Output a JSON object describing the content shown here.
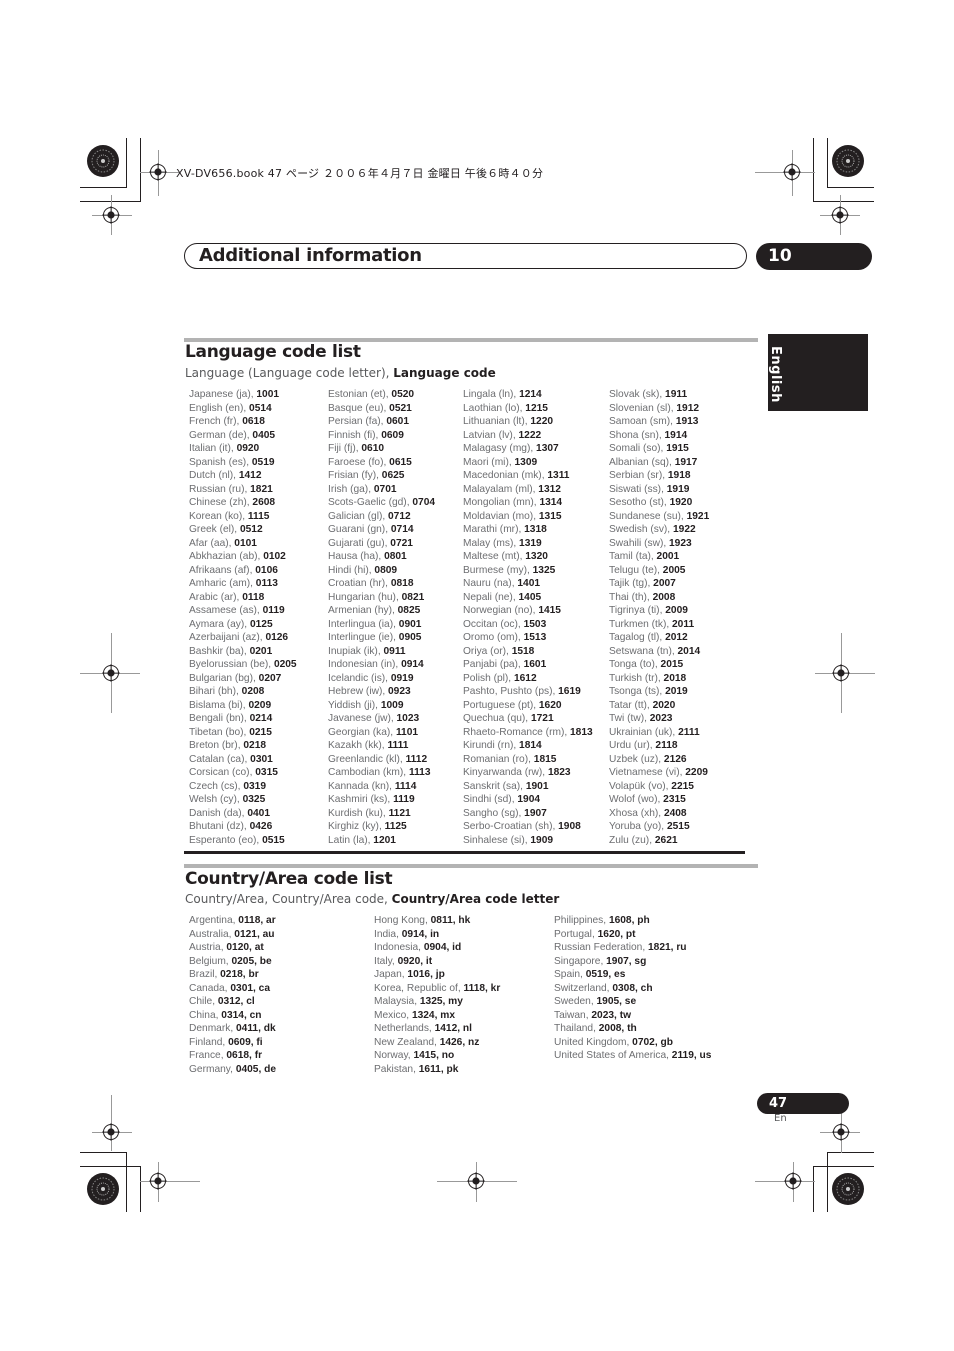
{
  "print_header": "XV-DV656.book  47 ページ  ２００６年４月７日  金曜日  午後６時４０分",
  "chapter": {
    "title": "Additional information",
    "number": "10"
  },
  "language_tab": "English",
  "language_section": {
    "title": "Language code list",
    "subtitle_plain": "Language (Language code letter), ",
    "subtitle_bold": "Language code",
    "columns": [
      [
        {
          "name": "Japanese (ja), ",
          "code": "1001"
        },
        {
          "name": "English (en), ",
          "code": "0514"
        },
        {
          "name": "French (fr), ",
          "code": "0618"
        },
        {
          "name": "German (de), ",
          "code": "0405"
        },
        {
          "name": "Italian (it), ",
          "code": "0920"
        },
        {
          "name": "Spanish (es), ",
          "code": "0519"
        },
        {
          "name": "Dutch (nl), ",
          "code": "1412"
        },
        {
          "name": "Russian (ru), ",
          "code": "1821"
        },
        {
          "name": "Chinese (zh), ",
          "code": "2608"
        },
        {
          "name": "Korean (ko), ",
          "code": "1115"
        },
        {
          "name": "Greek (el), ",
          "code": "0512"
        },
        {
          "name": "Afar (aa), ",
          "code": "0101"
        },
        {
          "name": "Abkhazian (ab), ",
          "code": "0102"
        },
        {
          "name": "Afrikaans (af), ",
          "code": "0106"
        },
        {
          "name": "Amharic (am), ",
          "code": "0113"
        },
        {
          "name": "Arabic (ar), ",
          "code": "0118"
        },
        {
          "name": "Assamese (as), ",
          "code": "0119"
        },
        {
          "name": "Aymara (ay), ",
          "code": "0125"
        },
        {
          "name": "Azerbaijani (az), ",
          "code": "0126"
        },
        {
          "name": "Bashkir (ba), ",
          "code": "0201"
        },
        {
          "name": "Byelorussian (be), ",
          "code": "0205"
        },
        {
          "name": "Bulgarian (bg), ",
          "code": "0207"
        },
        {
          "name": "Bihari (bh), ",
          "code": "0208"
        },
        {
          "name": "Bislama (bi), ",
          "code": "0209"
        },
        {
          "name": "Bengali (bn), ",
          "code": "0214"
        },
        {
          "name": "Tibetan (bo), ",
          "code": "0215"
        },
        {
          "name": "Breton (br), ",
          "code": "0218"
        },
        {
          "name": "Catalan (ca), ",
          "code": "0301"
        },
        {
          "name": "Corsican (co), ",
          "code": "0315"
        },
        {
          "name": "Czech (cs), ",
          "code": "0319"
        },
        {
          "name": "Welsh (cy), ",
          "code": "0325"
        },
        {
          "name": "Danish (da), ",
          "code": "0401"
        },
        {
          "name": "Bhutani (dz), ",
          "code": "0426"
        },
        {
          "name": "Esperanto (eo), ",
          "code": "0515"
        }
      ],
      [
        {
          "name": "Estonian (et), ",
          "code": "0520"
        },
        {
          "name": "Basque (eu), ",
          "code": "0521"
        },
        {
          "name": "Persian (fa), ",
          "code": "0601"
        },
        {
          "name": "Finnish (fi), ",
          "code": "0609"
        },
        {
          "name": "Fiji (fj), ",
          "code": "0610"
        },
        {
          "name": "Faroese (fo), ",
          "code": "0615"
        },
        {
          "name": "Frisian (fy), ",
          "code": "0625"
        },
        {
          "name": "Irish (ga), ",
          "code": "0701"
        },
        {
          "name": "Scots-Gaelic (gd), ",
          "code": "0704"
        },
        {
          "name": "Galician (gl), ",
          "code": "0712"
        },
        {
          "name": "Guarani (gn), ",
          "code": "0714"
        },
        {
          "name": "Gujarati (gu), ",
          "code": "0721"
        },
        {
          "name": "Hausa (ha), ",
          "code": "0801"
        },
        {
          "name": "Hindi (hi), ",
          "code": "0809"
        },
        {
          "name": "Croatian (hr), ",
          "code": "0818"
        },
        {
          "name": "Hungarian (hu), ",
          "code": "0821"
        },
        {
          "name": "Armenian (hy), ",
          "code": "0825"
        },
        {
          "name": "Interlingua (ia), ",
          "code": "0901"
        },
        {
          "name": "Interlingue (ie), ",
          "code": "0905"
        },
        {
          "name": "Inupiak (ik), ",
          "code": "0911"
        },
        {
          "name": "Indonesian (in), ",
          "code": "0914"
        },
        {
          "name": "Icelandic (is), ",
          "code": "0919"
        },
        {
          "name": "Hebrew (iw), ",
          "code": "0923"
        },
        {
          "name": "Yiddish (ji), ",
          "code": "1009"
        },
        {
          "name": "Javanese (jw), ",
          "code": "1023"
        },
        {
          "name": "Georgian (ka), ",
          "code": "1101"
        },
        {
          "name": "Kazakh (kk), ",
          "code": "1111"
        },
        {
          "name": "Greenlandic  (kl), ",
          "code": "1112"
        },
        {
          "name": "Cambodian (km), ",
          "code": "1113"
        },
        {
          "name": "Kannada (kn), ",
          "code": "1114"
        },
        {
          "name": "Kashmiri (ks), ",
          "code": "1119"
        },
        {
          "name": "Kurdish (ku), ",
          "code": "1121"
        },
        {
          "name": "Kirghiz (ky), ",
          "code": "1125"
        },
        {
          "name": "Latin (la), ",
          "code": "1201"
        }
      ],
      [
        {
          "name": "Lingala (ln), ",
          "code": "1214"
        },
        {
          "name": "Laothian (lo), ",
          "code": "1215"
        },
        {
          "name": "Lithuanian (lt), ",
          "code": "1220"
        },
        {
          "name": "Latvian (lv), ",
          "code": "1222"
        },
        {
          "name": "Malagasy (mg), ",
          "code": "1307"
        },
        {
          "name": "Maori (mi), ",
          "code": "1309"
        },
        {
          "name": "Macedonian (mk), ",
          "code": "1311"
        },
        {
          "name": "Malayalam  (ml), ",
          "code": "1312"
        },
        {
          "name": "Mongolian (mn), ",
          "code": "1314"
        },
        {
          "name": "Moldavian (mo), ",
          "code": "1315"
        },
        {
          "name": "Marathi (mr), ",
          "code": "1318"
        },
        {
          "name": "Malay  (ms), ",
          "code": "1319"
        },
        {
          "name": "Maltese (mt), ",
          "code": "1320"
        },
        {
          "name": "Burmese (my), ",
          "code": "1325"
        },
        {
          "name": "Nauru (na), ",
          "code": "1401"
        },
        {
          "name": "Nepali (ne), ",
          "code": "1405"
        },
        {
          "name": "Norwegian (no), ",
          "code": "1415"
        },
        {
          "name": "Occitan (oc), ",
          "code": "1503"
        },
        {
          "name": "Oromo (om), ",
          "code": "1513"
        },
        {
          "name": "Oriya (or), ",
          "code": "1518"
        },
        {
          "name": "Panjabi (pa), ",
          "code": "1601"
        },
        {
          "name": "Polish (pl), ",
          "code": "1612"
        },
        {
          "name": "Pashto, Pushto (ps), ",
          "code": "1619"
        },
        {
          "name": "Portuguese (pt), ",
          "code": "1620"
        },
        {
          "name": "Quechua (qu), ",
          "code": "1721"
        },
        {
          "name": "Rhaeto-Romance (rm), ",
          "code": "1813"
        },
        {
          "name": "Kirundi (rn), ",
          "code": "1814"
        },
        {
          "name": "Romanian (ro), ",
          "code": "1815"
        },
        {
          "name": "Kinyarwanda (rw), ",
          "code": "1823"
        },
        {
          "name": "Sanskrit (sa), ",
          "code": "1901"
        },
        {
          "name": "Sindhi (sd), ",
          "code": "1904"
        },
        {
          "name": "Sangho (sg), ",
          "code": "1907"
        },
        {
          "name": "Serbo-Croatian (sh), ",
          "code": "1908"
        },
        {
          "name": "Sinhalese (si), ",
          "code": "1909"
        }
      ],
      [
        {
          "name": "Slovak (sk), ",
          "code": "1911"
        },
        {
          "name": "Slovenian (sl), ",
          "code": "1912"
        },
        {
          "name": "Samoan (sm), ",
          "code": "1913"
        },
        {
          "name": "Shona (sn), ",
          "code": "1914"
        },
        {
          "name": "Somali (so), ",
          "code": "1915"
        },
        {
          "name": "Albanian (sq), ",
          "code": "1917"
        },
        {
          "name": "Serbian (sr), ",
          "code": "1918"
        },
        {
          "name": "Siswati (ss), ",
          "code": "1919"
        },
        {
          "name": "Sesotho (st), ",
          "code": "1920"
        },
        {
          "name": "Sundanese (su), ",
          "code": "1921"
        },
        {
          "name": "Swedish (sv), ",
          "code": "1922"
        },
        {
          "name": "Swahili (sw), ",
          "code": "1923"
        },
        {
          "name": "Tamil (ta), ",
          "code": "2001"
        },
        {
          "name": "Telugu (te), ",
          "code": "2005"
        },
        {
          "name": "Tajik (tg), ",
          "code": "2007"
        },
        {
          "name": "Thai (th), ",
          "code": "2008"
        },
        {
          "name": "Tigrinya (ti), ",
          "code": "2009"
        },
        {
          "name": "Turkmen (tk), ",
          "code": "2011"
        },
        {
          "name": "Tagalog (tl), ",
          "code": "2012"
        },
        {
          "name": "Setswana (tn), ",
          "code": "2014"
        },
        {
          "name": "Tonga (to), ",
          "code": "2015"
        },
        {
          "name": "Turkish (tr), ",
          "code": "2018"
        },
        {
          "name": "Tsonga (ts), ",
          "code": "2019"
        },
        {
          "name": "Tatar (tt), ",
          "code": "2020"
        },
        {
          "name": "Twi (tw), ",
          "code": "2023"
        },
        {
          "name": "Ukrainian (uk), ",
          "code": "2111"
        },
        {
          "name": "Urdu (ur), ",
          "code": "2118"
        },
        {
          "name": "Uzbek (uz), ",
          "code": "2126"
        },
        {
          "name": "Vietnamese (vi), ",
          "code": "2209"
        },
        {
          "name": "Volapük (vo), ",
          "code": "2215"
        },
        {
          "name": "Wolof (wo), ",
          "code": "2315"
        },
        {
          "name": "Xhosa (xh), ",
          "code": "2408"
        },
        {
          "name": "Yoruba (yo), ",
          "code": "2515"
        },
        {
          "name": "Zulu (zu), ",
          "code": "2621"
        }
      ]
    ]
  },
  "country_section": {
    "title": "Country/Area code list",
    "subtitle_plain": "Country/Area, Country/Area code, ",
    "subtitle_bold": "Country/Area code letter",
    "columns": [
      [
        {
          "name": "Argentina, ",
          "code": "0118, ar"
        },
        {
          "name": "Australia, ",
          "code": "0121, au"
        },
        {
          "name": "Austria, ",
          "code": "0120, at"
        },
        {
          "name": "Belgium, ",
          "code": "0205, be"
        },
        {
          "name": "Brazil, ",
          "code": "0218, br"
        },
        {
          "name": "Canada, ",
          "code": "0301, ca"
        },
        {
          "name": "Chile, ",
          "code": "0312, cl"
        },
        {
          "name": "China, ",
          "code": "0314, cn"
        },
        {
          "name": "Denmark, ",
          "code": "0411, dk"
        },
        {
          "name": "Finland, ",
          "code": "0609, fi"
        },
        {
          "name": "France, ",
          "code": "0618, fr"
        },
        {
          "name": "Germany, ",
          "code": "0405, de"
        }
      ],
      [
        {
          "name": "Hong Kong, ",
          "code": "0811, hk"
        },
        {
          "name": "India, ",
          "code": "0914, in"
        },
        {
          "name": "Indonesia, ",
          "code": "0904, id"
        },
        {
          "name": "Italy, ",
          "code": "0920, it"
        },
        {
          "name": "Japan, ",
          "code": "1016, jp"
        },
        {
          "name": "Korea, Republic of, ",
          "code": "1118, kr"
        },
        {
          "name": "Malaysia, ",
          "code": "1325, my"
        },
        {
          "name": "Mexico, ",
          "code": "1324, mx"
        },
        {
          "name": "Netherlands, ",
          "code": "1412, nl"
        },
        {
          "name": "New Zealand, ",
          "code": "1426, nz"
        },
        {
          "name": "Norway, ",
          "code": "1415, no"
        },
        {
          "name": "Pakistan, ",
          "code": "1611, pk"
        }
      ],
      [
        {
          "name": "Philippines, ",
          "code": "1608, ph"
        },
        {
          "name": "Portugal, ",
          "code": "1620, pt"
        },
        {
          "name": "Russian Federation, ",
          "code": "1821, ru"
        },
        {
          "name": "Singapore, ",
          "code": "1907, sg"
        },
        {
          "name": "Spain, ",
          "code": "0519, es"
        },
        {
          "name": "Switzerland, ",
          "code": "0308, ch"
        },
        {
          "name": "Sweden, ",
          "code": "1905, se"
        },
        {
          "name": "Taiwan, ",
          "code": "2023, tw"
        },
        {
          "name": "Thailand, ",
          "code": "2008, th"
        },
        {
          "name": "United Kingdom, ",
          "code": "0702, gb"
        },
        {
          "name": "United States of America, ",
          "code": "2119, us"
        }
      ]
    ]
  },
  "page": {
    "number": "47",
    "lang": "En"
  },
  "icons": {
    "registration": "registration-mark-icon",
    "starburst": "starburst-crop-icon"
  }
}
